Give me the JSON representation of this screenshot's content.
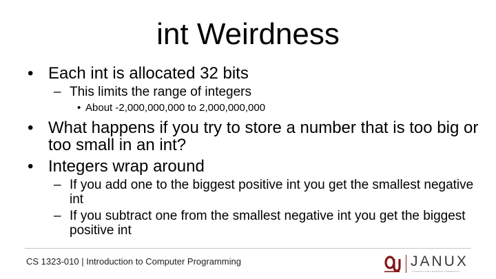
{
  "slide": {
    "title": "int Weirdness",
    "bullets": {
      "b1": "Each int is allocated 32 bits",
      "b1_1": "This limits the range of integers",
      "b1_1_1": "About -2,000,000,000 to 2,000,000,000",
      "b2": "What happens if you try to store a number that is too big or too small in an int?",
      "b3": "Integers wrap around",
      "b3_1": "If you add one to the biggest positive int you get the smallest negative int",
      "b3_2": "If you subtract one from the smallest negative int you get the biggest positive int"
    },
    "markers": {
      "bullet": "•",
      "dash": "–"
    }
  },
  "footer": {
    "course": "CS 1323-010 | Introduction to Computer Programming",
    "logo_text": "JANUX",
    "logo_tagline": "INTERACTIVE LEARNING COMMUNITY",
    "logo_color": "#841617",
    "logo_icon": "ou-logo-icon"
  }
}
